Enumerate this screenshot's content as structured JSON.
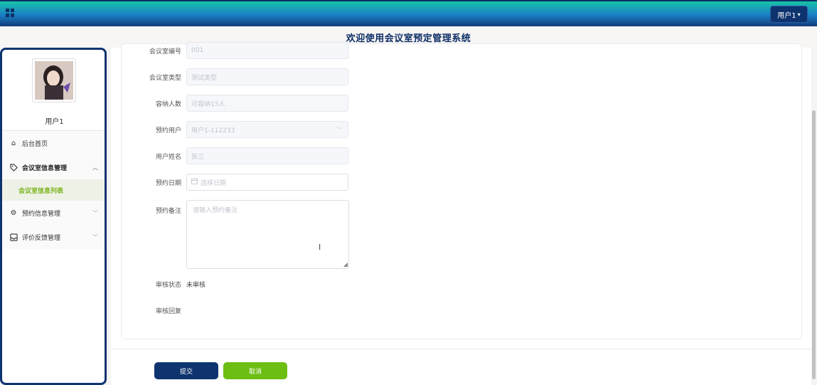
{
  "header": {
    "user_button": "用户1",
    "title": "欢迎使用会议室预定管理系统"
  },
  "sidebar": {
    "username": "用户1",
    "items": [
      {
        "label": "后台首页",
        "icon": "home-icon"
      },
      {
        "label": "会议室信息管理",
        "icon": "tag-icon",
        "expanded": true
      },
      {
        "label": "会议室信息列表",
        "sub": true,
        "active": true
      },
      {
        "label": "预约信息管理",
        "icon": "gear-icon"
      },
      {
        "label": "评价反馈管理",
        "icon": "inbox-icon"
      }
    ]
  },
  "form": {
    "room_no_label": "会议室编号",
    "room_no_value": "001",
    "room_type_label": "会议室类型",
    "room_type_value": "测试类型",
    "capacity_label": "容纳人数",
    "capacity_value": "可容纳15人",
    "user_label": "预约用户",
    "user_value": "用户1-112233",
    "name_label": "用户姓名",
    "name_value": "张三",
    "date_label": "预约日期",
    "date_placeholder": "选择日期",
    "note_label": "预约备注",
    "note_placeholder": "请输入预约备注",
    "status_label": "审核状态",
    "status_value": "未审核",
    "reply_label": "审核回复"
  },
  "actions": {
    "submit": "提交",
    "cancel": "取消"
  },
  "colors": {
    "primary": "#0e3470",
    "accent": "#6cbe12"
  }
}
